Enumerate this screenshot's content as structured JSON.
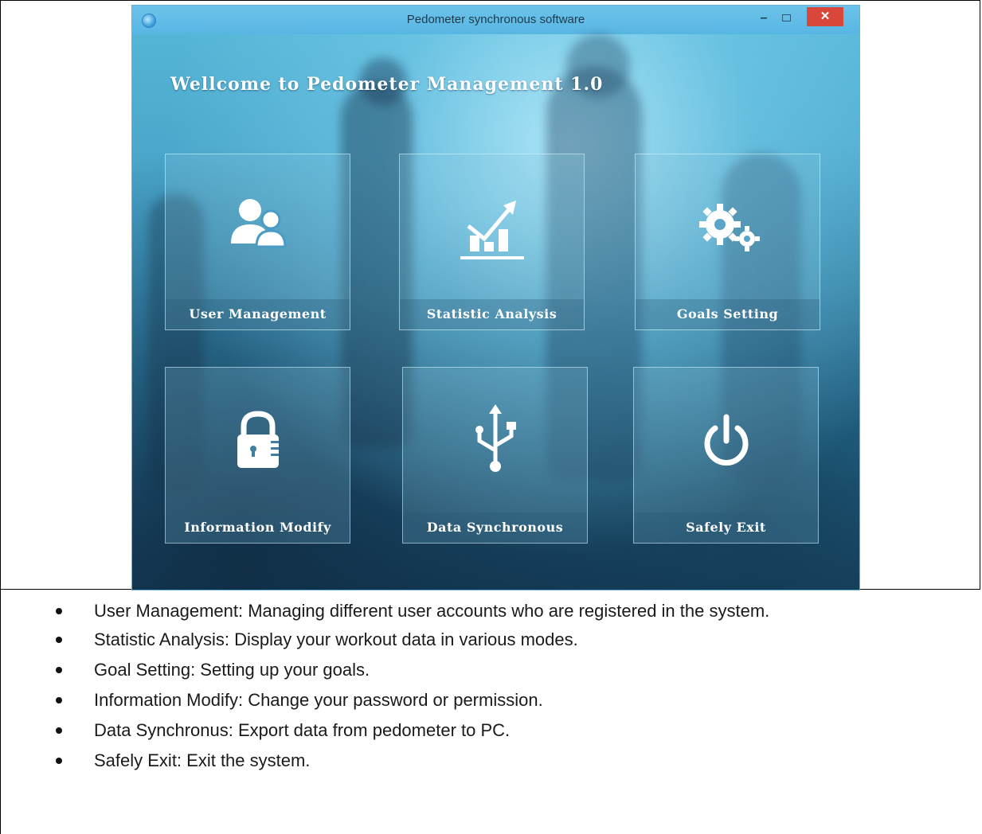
{
  "window": {
    "title": "Pedometer synchronous software",
    "close_glyph": "✕",
    "min_glyph": "–"
  },
  "welcome_text": "Wellcome to Pedometer Management 1.0",
  "tiles": [
    {
      "label": "User Management",
      "icon": "users-icon"
    },
    {
      "label": "Statistic Analysis",
      "icon": "chart-icon"
    },
    {
      "label": "Goals Setting",
      "icon": "gears-icon"
    },
    {
      "label": "Information Modify",
      "icon": "lock-icon"
    },
    {
      "label": "Data Synchronous",
      "icon": "usb-icon"
    },
    {
      "label": "Safely Exit",
      "icon": "power-icon"
    }
  ],
  "bullets": [
    "User Management: Managing different user accounts who are registered in the system.",
    "Statistic Analysis: Display your workout data in various modes.",
    "Goal Setting: Setting up your goals.",
    "Information Modify: Change your password or permission.",
    "Data Synchronus: Export data from pedometer to PC.",
    "Safely Exit: Exit the system."
  ],
  "colors": {
    "close_button": "#d9463a",
    "title_bar": "#58b6e3",
    "tile_label_text": "#ffffff"
  }
}
